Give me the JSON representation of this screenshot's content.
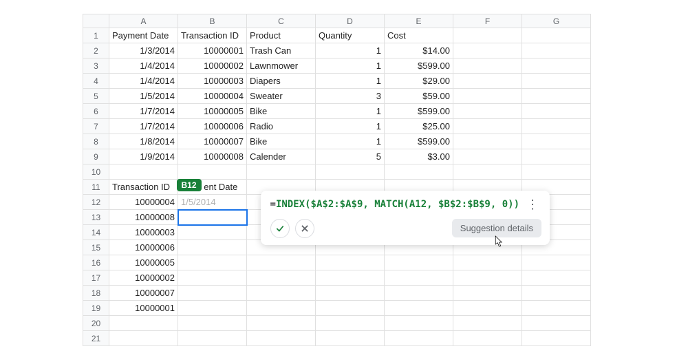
{
  "columns": [
    "A",
    "B",
    "C",
    "D",
    "E",
    "F",
    "G"
  ],
  "rowCount": 21,
  "headers": {
    "A": "Payment Date",
    "B": "Transaction ID",
    "C": "Product",
    "D": "Quantity",
    "E": "Cost"
  },
  "data_rows": [
    {
      "A": "1/3/2014",
      "B": "10000001",
      "C": "Trash Can",
      "D": "1",
      "E": "$14.00"
    },
    {
      "A": "1/4/2014",
      "B": "10000002",
      "C": "Lawnmower",
      "D": "1",
      "E": "$599.00"
    },
    {
      "A": "1/4/2014",
      "B": "10000003",
      "C": "Diapers",
      "D": "1",
      "E": "$29.00"
    },
    {
      "A": "1/5/2014",
      "B": "10000004",
      "C": "Sweater",
      "D": "3",
      "E": "$59.00"
    },
    {
      "A": "1/7/2014",
      "B": "10000005",
      "C": "Bike",
      "D": "1",
      "E": "$599.00"
    },
    {
      "A": "1/7/2014",
      "B": "10000006",
      "C": "Radio",
      "D": "1",
      "E": "$25.00"
    },
    {
      "A": "1/8/2014",
      "B": "10000007",
      "C": "Bike",
      "D": "1",
      "E": "$599.00"
    },
    {
      "A": "1/9/2014",
      "B": "10000008",
      "C": "Calender",
      "D": "5",
      "E": "$3.00"
    }
  ],
  "lookup_header": {
    "A": "Transaction ID",
    "B_fragment": "ent Date"
  },
  "lookup_rows": [
    {
      "A": "10000004",
      "B_ghost": "1/5/2014"
    },
    {
      "A": "10000008"
    },
    {
      "A": "10000003"
    },
    {
      "A": "10000006"
    },
    {
      "A": "10000005"
    },
    {
      "A": "10000002"
    },
    {
      "A": "10000007"
    },
    {
      "A": "10000001"
    }
  ],
  "active_cell_badge": "B12",
  "formula": {
    "text": "=INDEX($A$2:$A$9, MATCH(A12, $B$2:$B$9, 0))",
    "eq": "=",
    "fn1": "INDEX",
    "open1": "(",
    "ref1": "$A$2:$A$9",
    "comma1": ", ",
    "fn2": "MATCH",
    "open2": "(",
    "ref2": "A12",
    "comma2": ", ",
    "ref3": "$B$2:$B$9",
    "comma3": ", ",
    "lit": "0",
    "close2": ")",
    "close1": ")"
  },
  "suggestion_chip": "Suggestion details",
  "colors": {
    "accent_green": "#188038",
    "selection_blue": "#1a73e8"
  }
}
